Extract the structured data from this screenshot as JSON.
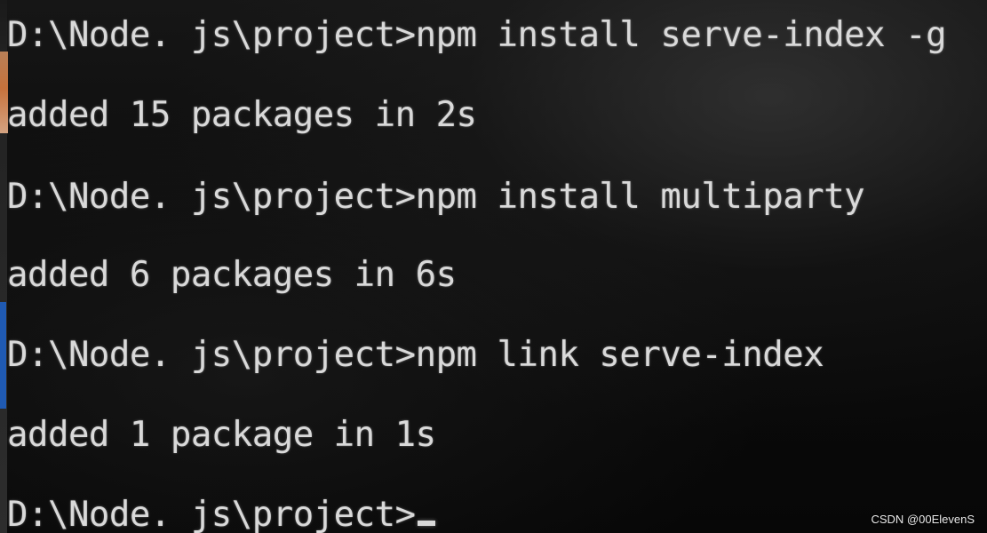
{
  "terminal": {
    "lines": [
      {
        "text": "D:\\Node. js\\project>npm install serve-index -g"
      },
      {
        "text": "added 15 packages in 2s"
      },
      {
        "text": "D:\\Node. js\\project>npm install multiparty"
      },
      {
        "text": "added 6 packages in 6s"
      },
      {
        "text": "D:\\Node. js\\project>npm link serve-index"
      },
      {
        "text": "added 1 package in 1s"
      },
      {
        "text": "D:\\Node. js\\project>"
      }
    ],
    "text_color": "#d9d9d9",
    "background_color": "#0c0c0c"
  },
  "watermark": {
    "text": "CSDN @00ElevenS"
  }
}
